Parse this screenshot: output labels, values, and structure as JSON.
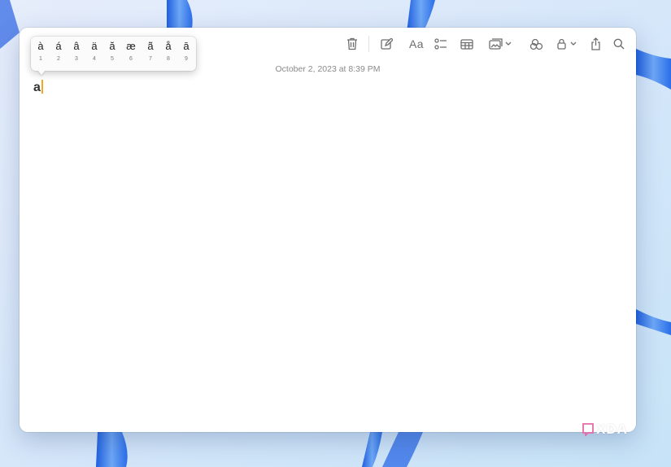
{
  "note": {
    "date": "October 2, 2023 at 8:39 PM",
    "body_text": "a"
  },
  "accent_popup": {
    "items": [
      {
        "char": "à",
        "num": "1"
      },
      {
        "char": "á",
        "num": "2"
      },
      {
        "char": "â",
        "num": "3"
      },
      {
        "char": "ä",
        "num": "4"
      },
      {
        "char": "ă",
        "num": "5"
      },
      {
        "char": "æ",
        "num": "6"
      },
      {
        "char": "ã",
        "num": "7"
      },
      {
        "char": "å",
        "num": "8"
      },
      {
        "char": "ā",
        "num": "9"
      }
    ]
  },
  "toolbar": {
    "format_label": "Aa",
    "icons": [
      "trash-icon",
      "compose-icon",
      "format-text-icon",
      "checklist-icon",
      "table-icon",
      "media-icon",
      "chevron-down-icon",
      "collaborate-icon",
      "lock-icon",
      "share-icon",
      "search-icon"
    ]
  },
  "watermark": {
    "text": "XDA"
  },
  "colors": {
    "caret": "#f5a623",
    "wallpaper_blue": "#2f6fe8",
    "toolbar_icon": "#6e6e6e"
  }
}
